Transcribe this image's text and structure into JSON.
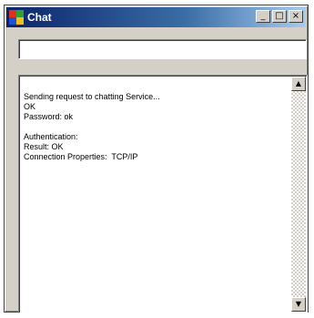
{
  "window": {
    "title": "Chat",
    "buttons": {
      "minimize": "_",
      "maximize": "□",
      "close": "×"
    }
  },
  "input": {
    "value": "",
    "placeholder": ""
  },
  "output": {
    "lines": [
      "Sending request to chatting Service...",
      "OK",
      "Password: ok",
      "",
      "Authentication:",
      "Result: OK",
      "Connection Properties:  TCP/IP"
    ]
  },
  "scrollbar": {
    "up_glyph": "▲",
    "down_glyph": "▼"
  },
  "colors": {
    "titlebar_start": "#0a246a",
    "titlebar_end": "#a6caf0",
    "window_face": "#d4d0c8"
  },
  "icons": {
    "app": "app-icon",
    "minimize": "minimize-icon",
    "maximize": "maximize-icon",
    "close": "close-icon"
  }
}
